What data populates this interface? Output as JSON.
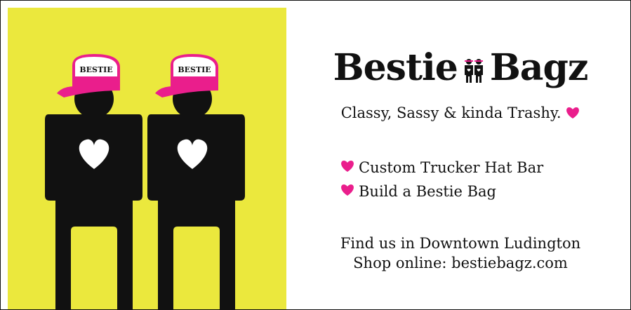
{
  "brand": {
    "name_left": "Bestie",
    "name_right": "Bagz",
    "tagline": "Classy, Sassy & kinda Trashy."
  },
  "hat_label_left": "BESTIE",
  "hat_label_right": "BESTIE",
  "services": [
    {
      "label": "Custom Trucker Hat Bar",
      "icon": "heart-icon"
    },
    {
      "label": "Build a Bestie Bag",
      "icon": "heart-icon"
    }
  ],
  "location": {
    "line1": "Find us in Downtown Ludington",
    "line2": "Shop online: bestiebagz.com"
  },
  "colors": {
    "background_yellow": "#ebe83d",
    "hat_pink": "#ea1e8c",
    "figure_black": "#111111",
    "heart_pink": "#ea1e8c"
  }
}
